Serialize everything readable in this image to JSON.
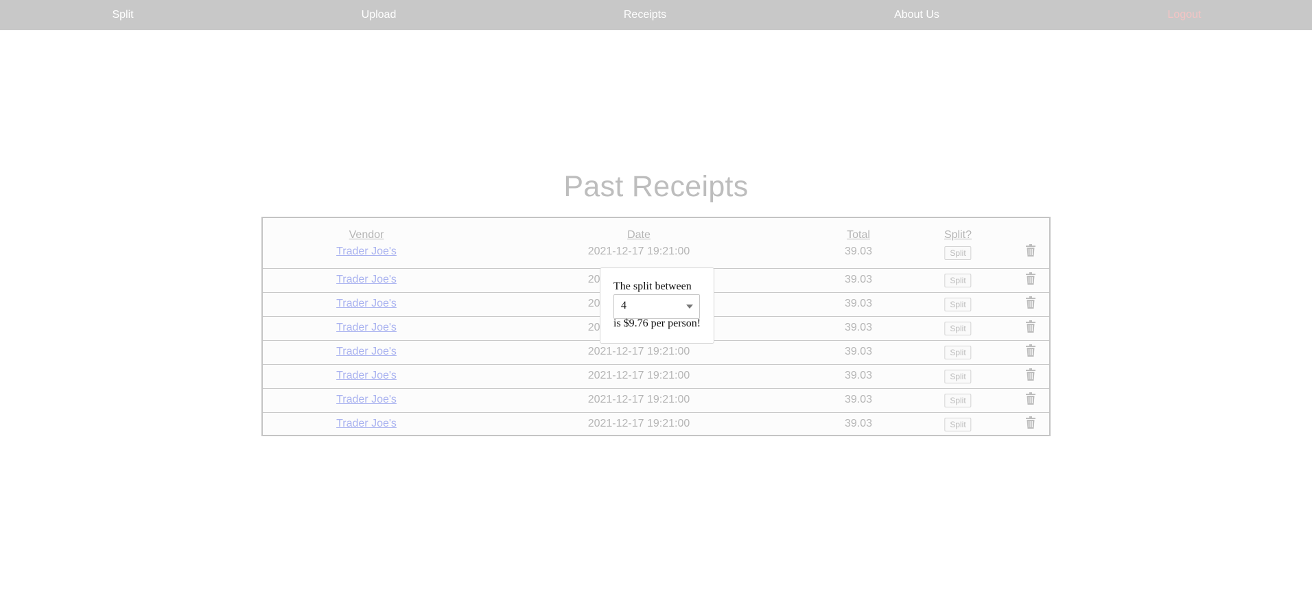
{
  "nav": {
    "split": "Split",
    "upload": "Upload",
    "receipts": "Receipts",
    "about": "About Us",
    "logout": "Logout"
  },
  "page_title": "Past Receipts",
  "table": {
    "headers": {
      "vendor": "Vendor",
      "date": "Date",
      "total": "Total",
      "split": "Split?"
    },
    "split_button_label": "Split",
    "rows": [
      {
        "vendor": "Trader Joe's",
        "date": "2021-12-17 19:21:00",
        "total": "39.03"
      },
      {
        "vendor": "Trader Joe's",
        "date": "2021-12-17 19:21:00",
        "total": "39.03"
      },
      {
        "vendor": "Trader Joe's",
        "date": "2021-12-17 19:21:00",
        "total": "39.03"
      },
      {
        "vendor": "Trader Joe's",
        "date": "2021-12-17 19:21:00",
        "total": "39.03"
      },
      {
        "vendor": "Trader Joe's",
        "date": "2021-12-17 19:21:00",
        "total": "39.03"
      },
      {
        "vendor": "Trader Joe's",
        "date": "2021-12-17 19:21:00",
        "total": "39.03"
      },
      {
        "vendor": "Trader Joe's",
        "date": "2021-12-17 19:21:00",
        "total": "39.03"
      },
      {
        "vendor": "Trader Joe's",
        "date": "2021-12-17 19:21:00",
        "total": "39.03"
      }
    ]
  },
  "split_popup": {
    "prefix": "The split between",
    "people_selected": "4",
    "result": "is $9.76 per person!"
  },
  "icons": {
    "row_delete": "trash-icon",
    "select_caret": "chevron-down-icon"
  },
  "colors": {
    "navbar_bg": "#c8c8c8",
    "logout": "#f3c4c4",
    "link": "#aab3f0"
  }
}
